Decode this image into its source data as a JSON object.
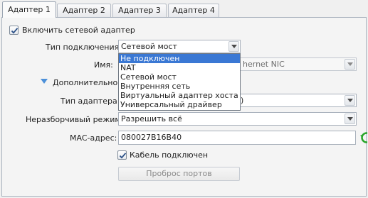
{
  "tabs": [
    "Адаптер 1",
    "Адаптер 2",
    "Адаптер 3",
    "Адаптер 4"
  ],
  "enable_adapter_label": "Включить сетевой адаптер",
  "attached_to": {
    "label": "Тип подключения:",
    "value": "Сетевой мост",
    "options": [
      "Не подключен",
      "NAT",
      "Сетевой мост",
      "Внутренняя сеть",
      "Виртуальный адаптер хоста",
      "Универсальный драйвер"
    ],
    "highlighted": "Не подключен"
  },
  "name": {
    "label": "Имя:",
    "value": "hernet NIC"
  },
  "advanced_label": "Дополнительно",
  "adapter_type": {
    "label": "Тип адаптера:",
    "value": ")"
  },
  "promiscuous": {
    "label": "Неразборчивый режим:",
    "value": "Разрешить всё"
  },
  "mac": {
    "label": "MAC-адрес:",
    "value": "080027B16B40"
  },
  "cable_label": "Кабель подключен",
  "port_forwarding_label": "Проброс портов",
  "colors": {
    "accent": "#3a78d4",
    "refresh": "#2aa52a",
    "disclosure": "#4d90d9"
  }
}
